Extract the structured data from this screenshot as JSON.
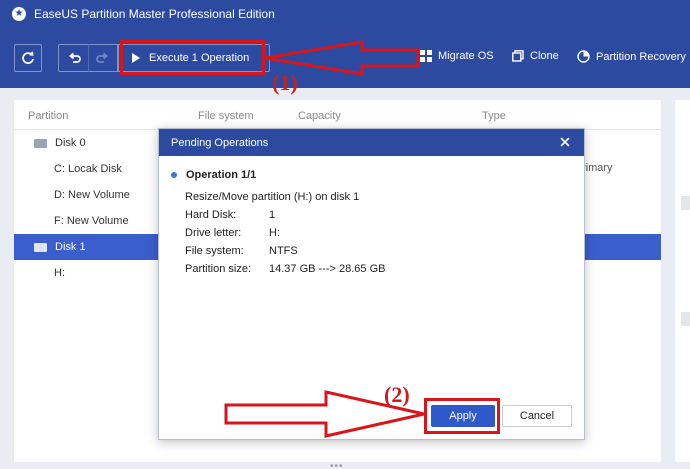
{
  "app": {
    "title": "EaseUS Partition Master Professional Edition"
  },
  "toolbar": {
    "execute_label": "Execute 1 Operation",
    "migrate_label": "Migrate OS",
    "clone_label": "Clone",
    "recovery_label": "Partition Recovery"
  },
  "table": {
    "headers": {
      "partition": "Partition",
      "filesystem": "File system",
      "capacity": "Capacity",
      "type": "Type"
    },
    "rows": [
      {
        "label": "Disk 0"
      },
      {
        "label": "C: Locak Disk"
      },
      {
        "label": "D: New Volume"
      },
      {
        "label": "F: New Volume"
      },
      {
        "label": "Disk 1"
      },
      {
        "label": "H:"
      }
    ],
    "partial_type_text": "rimary"
  },
  "dialog": {
    "title": "Pending Operations",
    "op_title": "Operation 1/1",
    "op_desc": "Resize/Move partition (H:) on disk 1",
    "fields": [
      {
        "key": "Hard Disk:",
        "value": "1"
      },
      {
        "key": "Drive letter:",
        "value": "H:"
      },
      {
        "key": "File system:",
        "value": "NTFS"
      },
      {
        "key": "Partition size:",
        "value": "14.37 GB ---> 28.65 GB"
      }
    ],
    "apply_label": "Apply",
    "cancel_label": "Cancel"
  },
  "annotations": {
    "label1": "(1)",
    "label2": "(2)"
  },
  "colors": {
    "brand": "#2c4ba0",
    "selection": "#3a5fcd",
    "annotation": "#d9151c"
  },
  "footer": {
    "dots": "•••"
  }
}
